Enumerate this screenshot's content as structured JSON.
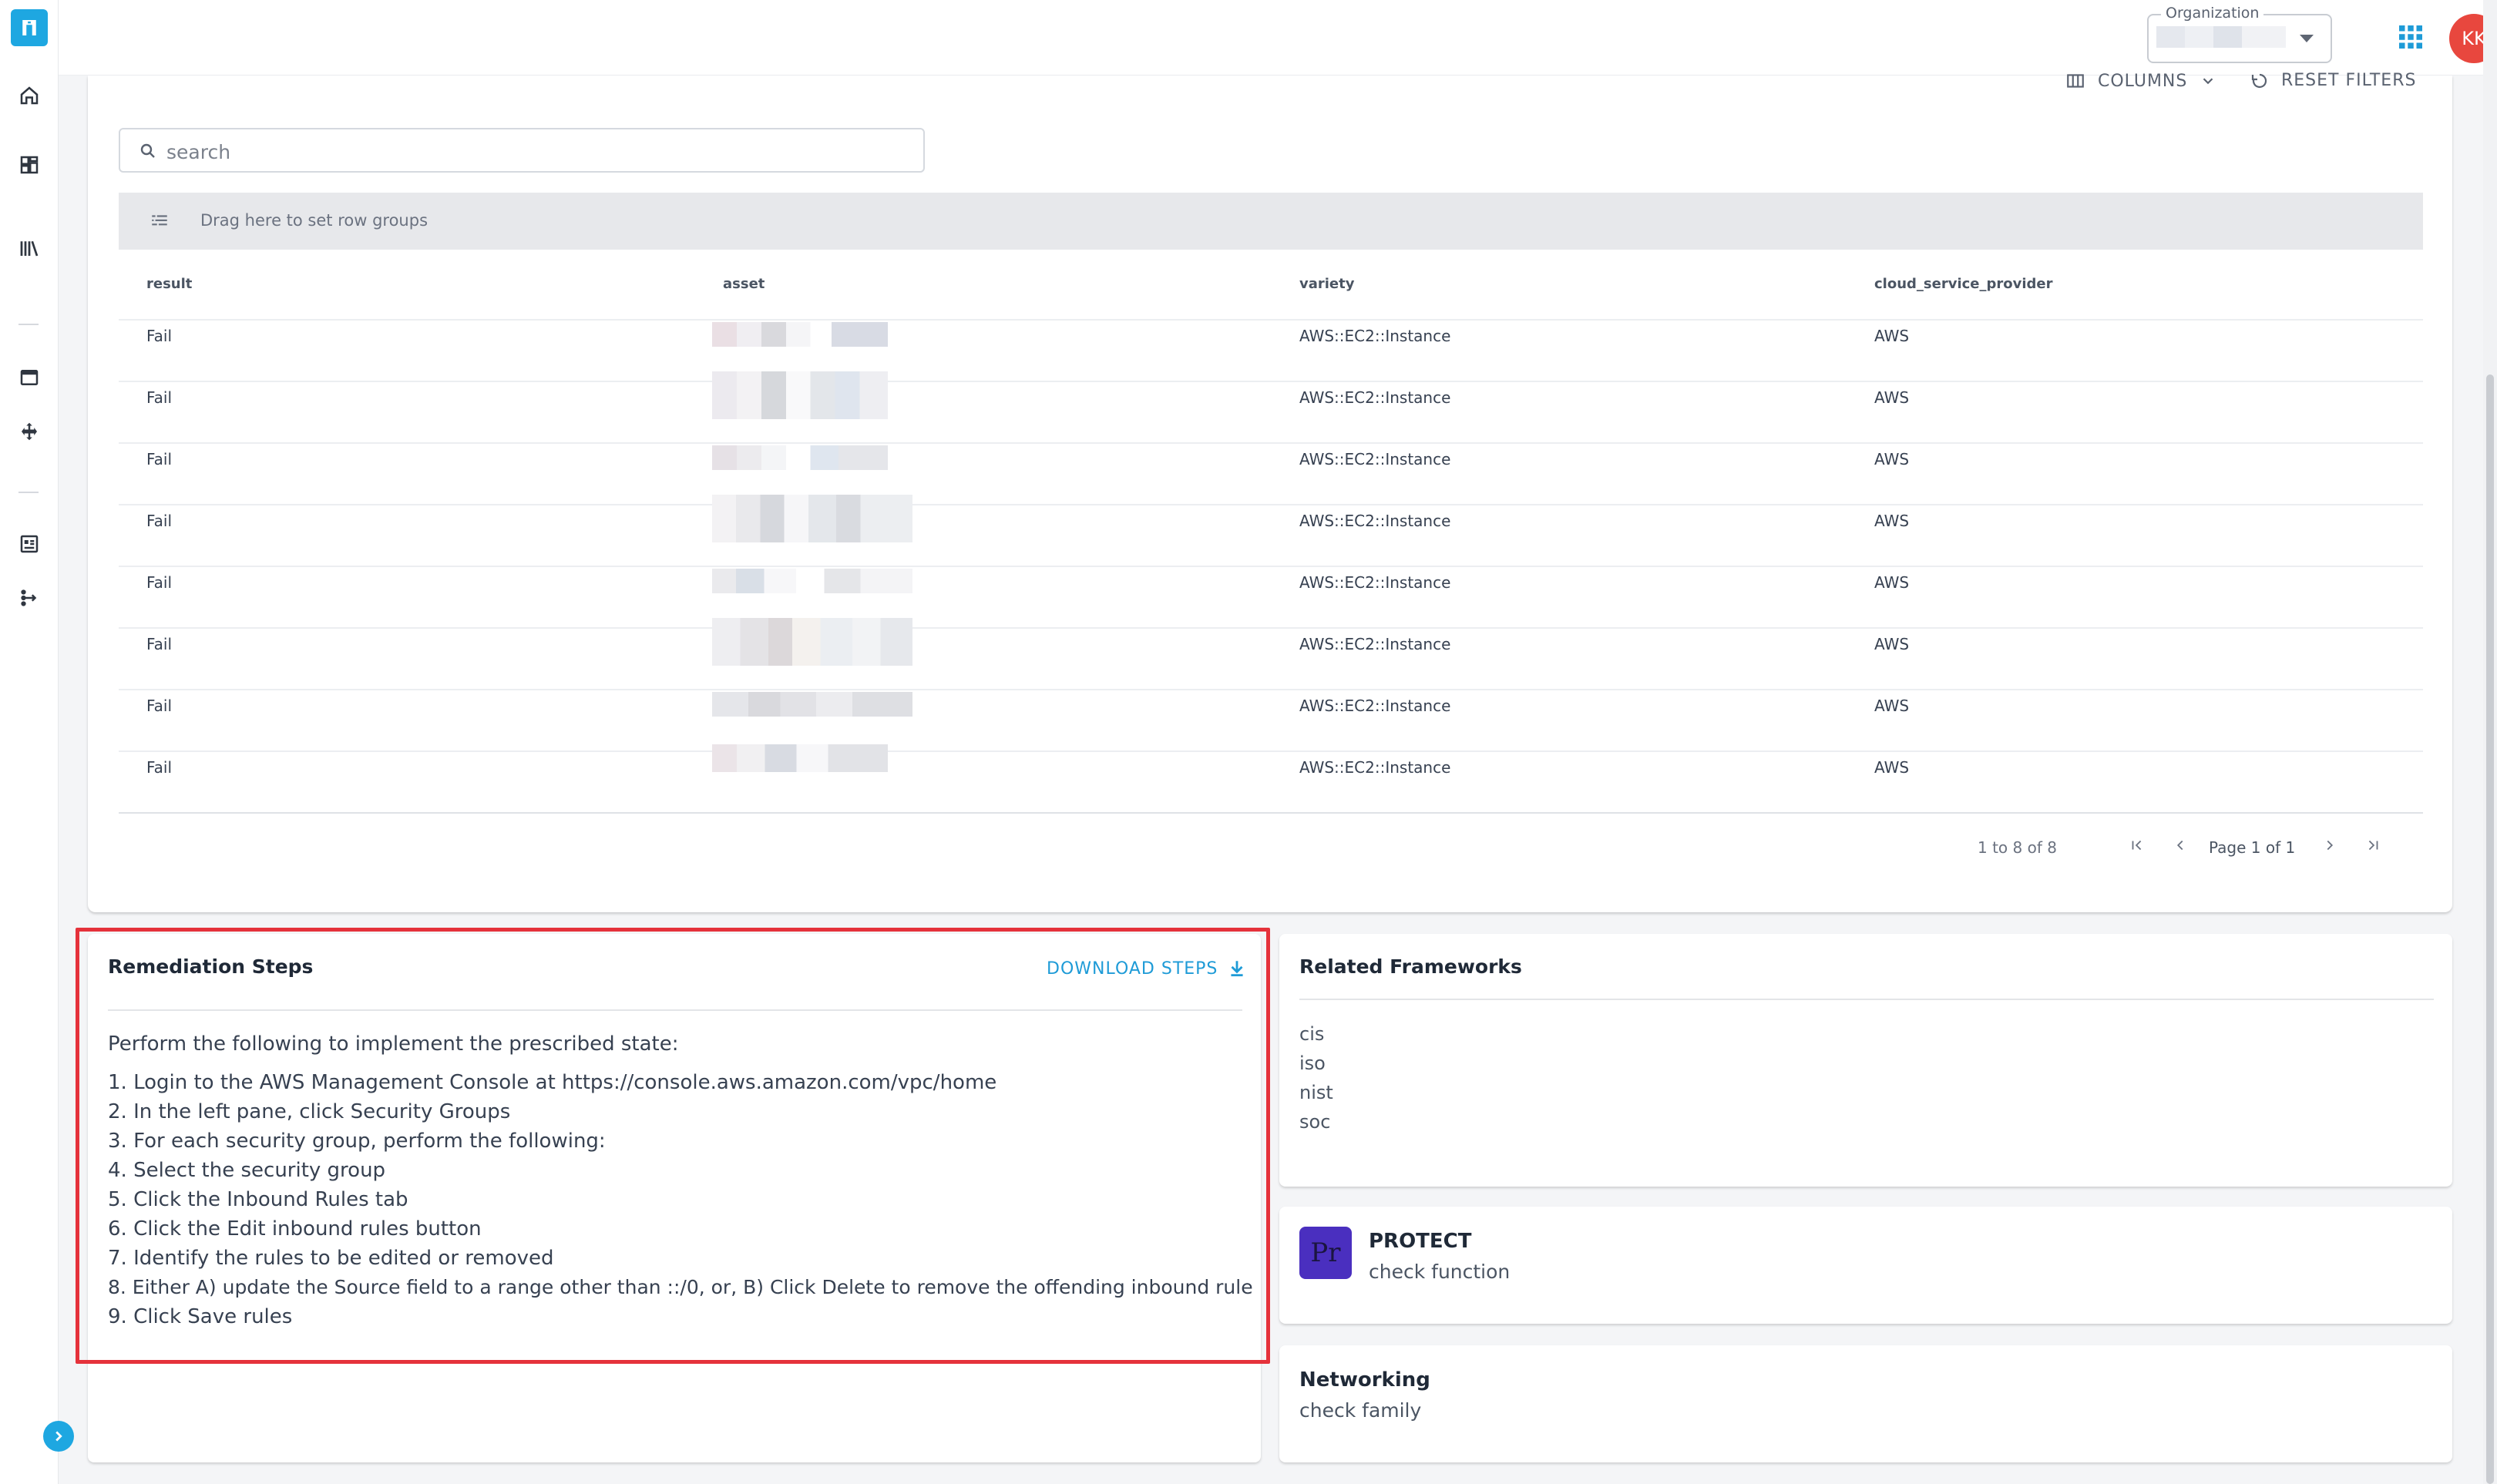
{
  "header": {
    "org_label": "Organization",
    "avatar_initials": "KK"
  },
  "table_card": {
    "columns_label": "COLUMNS",
    "reset_label": "RESET FILTERS",
    "search_placeholder": "search",
    "group_bar_text": "Drag here to set row groups",
    "headers": [
      "result",
      "asset",
      "variety",
      "cloud_service_provider"
    ],
    "rows": [
      {
        "result": "Fail",
        "variety": "AWS::EC2::Instance",
        "provider": "AWS"
      },
      {
        "result": "Fail",
        "variety": "AWS::EC2::Instance",
        "provider": "AWS"
      },
      {
        "result": "Fail",
        "variety": "AWS::EC2::Instance",
        "provider": "AWS"
      },
      {
        "result": "Fail",
        "variety": "AWS::EC2::Instance",
        "provider": "AWS"
      },
      {
        "result": "Fail",
        "variety": "AWS::EC2::Instance",
        "provider": "AWS"
      },
      {
        "result": "Fail",
        "variety": "AWS::EC2::Instance",
        "provider": "AWS"
      },
      {
        "result": "Fail",
        "variety": "AWS::EC2::Instance",
        "provider": "AWS"
      },
      {
        "result": "Fail",
        "variety": "AWS::EC2::Instance",
        "provider": "AWS"
      }
    ],
    "pager_info": "1 to 8 of 8",
    "page_label": "Page 1 of 1"
  },
  "remediation": {
    "title": "Remediation Steps",
    "download_label": "DOWNLOAD STEPS",
    "intro": "Perform the following to implement the prescribed state:",
    "steps": [
      "1. Login to the AWS Management Console at https://console.aws.amazon.com/vpc/home",
      "2. In the left pane, click Security Groups",
      "3. For each security group, perform the following:",
      "4. Select the security group",
      "5. Click the Inbound Rules tab",
      "6. Click the Edit inbound rules button",
      "7. Identify the rules to be edited or removed",
      "8. Either A) update the Source field to a range other than ::/0, or, B) Click Delete to remove the offending inbound rule",
      "9. Click Save rules"
    ]
  },
  "frameworks": {
    "title": "Related Frameworks",
    "items": [
      "cis",
      "iso",
      "nist",
      "soc"
    ]
  },
  "function_card": {
    "badge": "Pr",
    "title": "PROTECT",
    "subtitle": "check function"
  },
  "family_card": {
    "title": "Networking",
    "subtitle": "check family"
  },
  "colors": {
    "accent": "#1e9bd7",
    "highlight_outline": "#e5323b",
    "avatar": "#e8473e",
    "protect_badge": "#4a2fbf"
  }
}
